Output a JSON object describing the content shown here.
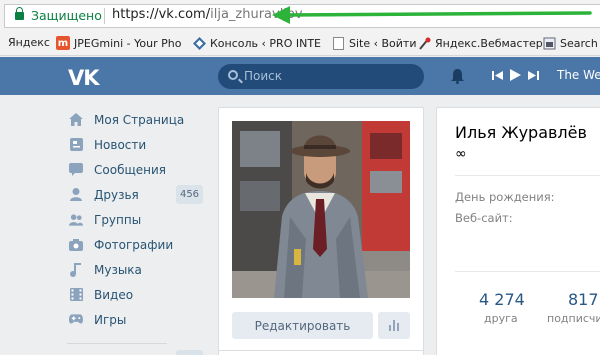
{
  "browser": {
    "secure_label": "Защищено",
    "url_host": "https://vk.com/",
    "url_path": "ilja_zhuravljov",
    "bookmarks": [
      {
        "label": "Яндекс",
        "icon": "none"
      },
      {
        "label": "JPEGmini - Your Pho",
        "icon": "m-icon"
      },
      {
        "label": "Консоль ‹ PRO INTE",
        "icon": "diamond-icon"
      },
      {
        "label": "Site ‹ Войти",
        "icon": "page-icon"
      },
      {
        "label": "Яндекс.Вебмастер",
        "icon": "pin-icon"
      },
      {
        "label": "Search",
        "icon": "lock-page-icon"
      }
    ]
  },
  "header": {
    "logo": "VK",
    "search_placeholder": "Поиск",
    "track": "The Wee"
  },
  "sidebar": {
    "items": [
      {
        "label": "Моя Страница",
        "icon": "home-icon",
        "count": ""
      },
      {
        "label": "Новости",
        "icon": "news-icon",
        "count": ""
      },
      {
        "label": "Сообщения",
        "icon": "messages-icon",
        "count": ""
      },
      {
        "label": "Друзья",
        "icon": "friends-icon",
        "count": "456"
      },
      {
        "label": "Группы",
        "icon": "groups-icon",
        "count": ""
      },
      {
        "label": "Фотографии",
        "icon": "camera-icon",
        "count": ""
      },
      {
        "label": "Музыка",
        "icon": "music-icon",
        "count": ""
      },
      {
        "label": "Видео",
        "icon": "video-icon",
        "count": ""
      },
      {
        "label": "Игры",
        "icon": "games-icon",
        "count": ""
      }
    ]
  },
  "profile": {
    "edit_button": "Редактировать",
    "name": "Илья Журавлёв",
    "status": "∞",
    "birthday_label": "День рождения:",
    "website_label": "Веб-сайт:",
    "counters": [
      {
        "value": "4 274",
        "label": "друга"
      },
      {
        "value": "817",
        "label": "подписчи"
      }
    ]
  },
  "colors": {
    "vk_blue": "#4a76a8",
    "secure_green": "#0b8043",
    "arrow_green": "#2bb33a",
    "link": "#2a5885"
  }
}
